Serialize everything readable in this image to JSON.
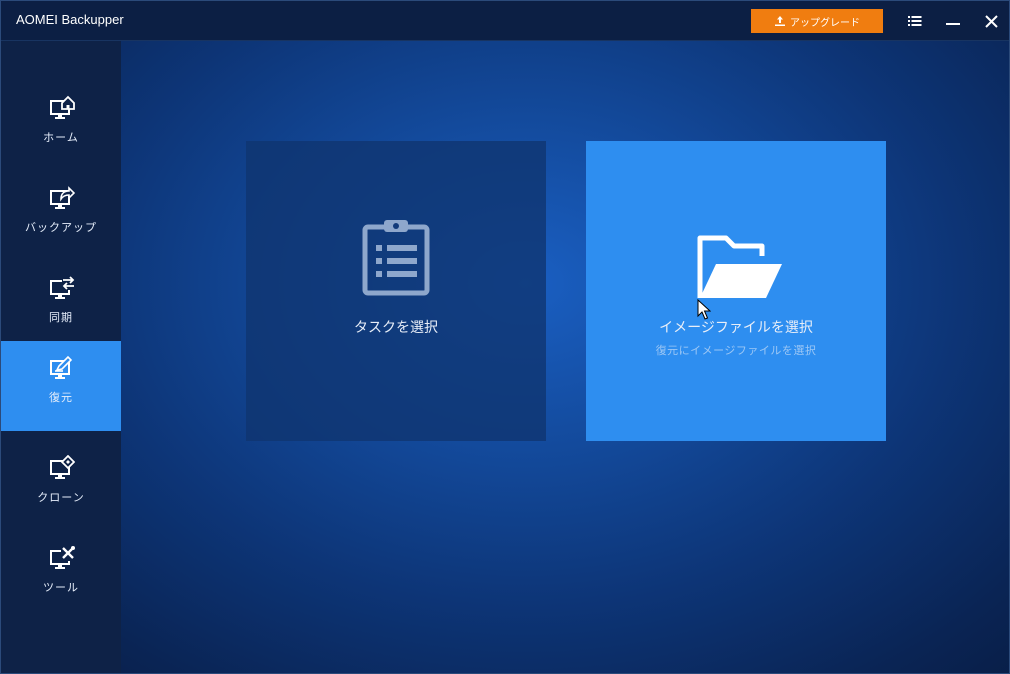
{
  "window": {
    "title": "AOMEI Backupper"
  },
  "titlebar": {
    "upgrade_label": "アップグレード",
    "upgrade_icon": "upload-arrow-icon",
    "menu_icon": "list-icon",
    "minimize_icon": "minimize-icon",
    "close_icon": "close-icon"
  },
  "sidebar": {
    "items": [
      {
        "label": "ホーム",
        "icon": "home-monitor-icon",
        "active": false
      },
      {
        "label": "バックアップ",
        "icon": "backup-monitor-icon",
        "active": false
      },
      {
        "label": "同期",
        "icon": "sync-monitor-icon",
        "active": false
      },
      {
        "label": "復元",
        "icon": "restore-monitor-icon",
        "active": true
      },
      {
        "label": "クローン",
        "icon": "clone-monitor-icon",
        "active": false
      },
      {
        "label": "ツール",
        "icon": "tools-monitor-icon",
        "active": false
      }
    ]
  },
  "main": {
    "cards": [
      {
        "title": "タスクを選択",
        "subtitle": "",
        "icon": "clipboard-list-icon"
      },
      {
        "title": "イメージファイルを選択",
        "subtitle": "復元にイメージファイルを選択",
        "icon": "folder-open-icon"
      }
    ]
  },
  "colors": {
    "accent": "#2e8ef0",
    "upgrade": "#f07d10",
    "sidebar_bg": "#0e2247",
    "titlebar_bg": "#0c1f44"
  }
}
